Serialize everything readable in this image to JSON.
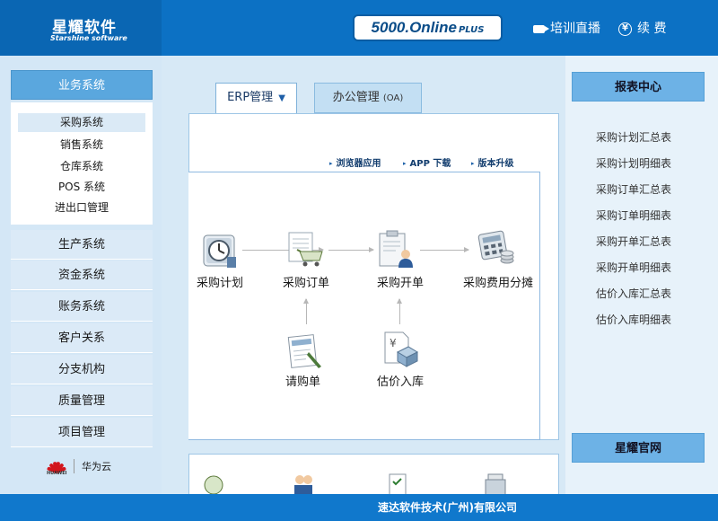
{
  "header": {
    "logo_cn": "星耀软件",
    "logo_en": "Starshine software",
    "product_name": "5000.Online",
    "product_suffix": "PLUS",
    "training_label": "培训直播",
    "renew_label": "续 费",
    "renew_icon_glyph": "¥"
  },
  "sidebar": {
    "category": "业务系统",
    "submenu": [
      "采购系统",
      "销售系统",
      "仓库系统",
      "POS 系统",
      "进出口管理"
    ],
    "active_sub": 0,
    "items": [
      "生产系统",
      "资金系统",
      "账务系统",
      "客户关系",
      "分支机构",
      "质量管理",
      "项目管理"
    ],
    "partner": {
      "brand": "HUAWEI",
      "name": "华为云"
    }
  },
  "tabs": [
    {
      "label": "ERP管理",
      "arrow": "▼",
      "active": true
    },
    {
      "label": "办公管理",
      "suffix": "(OA)",
      "active": false
    }
  ],
  "quick_links": [
    "浏览器应用",
    "APP 下载",
    "版本升级"
  ],
  "flow": {
    "nodes": [
      "采购计划",
      "采购订单",
      "采购开单",
      "采购费用分摊",
      "请购单",
      "估价入库"
    ]
  },
  "right_panel": {
    "title": "报表中心",
    "reports": [
      "采购计划汇总表",
      "采购计划明细表",
      "采购订单汇总表",
      "采购订单明细表",
      "采购开单汇总表",
      "采购开单明细表",
      "估价入库汇总表",
      "估价入库明细表"
    ],
    "website_label": "星耀官网"
  },
  "footer": {
    "company": "速达软件技术(广州)有限公司"
  },
  "colors": {
    "header_blue": "#0c71c4",
    "logo_blue": "#0a66b3",
    "accent_blue": "#5aa7de",
    "footer_blue": "#1078cc"
  }
}
